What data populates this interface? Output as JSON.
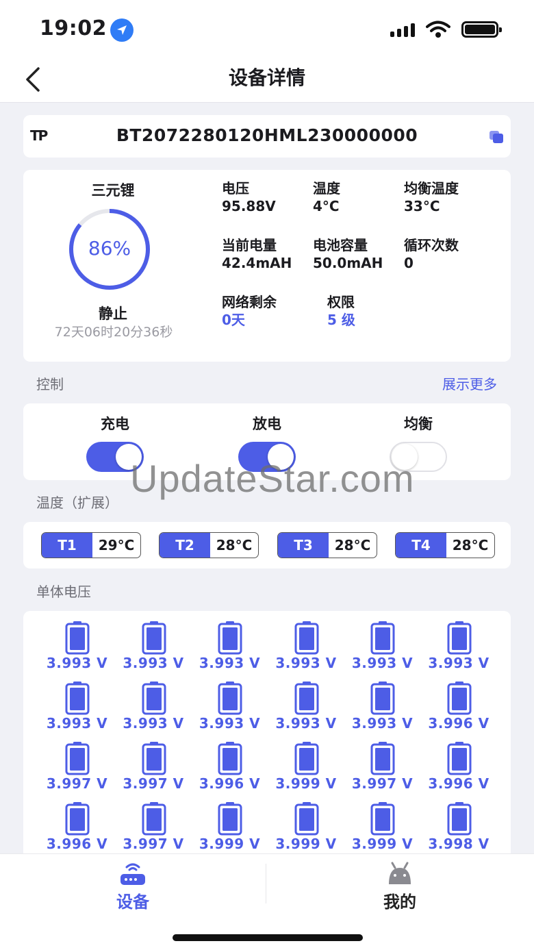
{
  "status_bar": {
    "time": "19:02"
  },
  "nav": {
    "title": "设备详情"
  },
  "device": {
    "brand": "TP",
    "id": "BT2072280120HML230000000"
  },
  "battery": {
    "type": "三元锂",
    "soc_percent": 86,
    "soc_text": "86%",
    "state": "静止",
    "duration": "72天06时20分36秒",
    "stats": [
      {
        "label": "电压",
        "value": "95.88V"
      },
      {
        "label": "温度",
        "value": "4°C"
      },
      {
        "label": "均衡温度",
        "value": "33°C"
      },
      {
        "label": "当前电量",
        "value": "42.4mAH"
      },
      {
        "label": "电池容量",
        "value": "50.0mAH"
      },
      {
        "label": "循环次数",
        "value": "0"
      },
      {
        "label": "网络剩余",
        "value": "0天"
      },
      {
        "label": "权限",
        "value": "5 级"
      }
    ]
  },
  "control": {
    "section_label": "控制",
    "show_more": "展示更多",
    "items": [
      {
        "label": "充电",
        "on": true
      },
      {
        "label": "放电",
        "on": true
      },
      {
        "label": "均衡",
        "on": false
      }
    ]
  },
  "temperature": {
    "section_label": "温度（扩展）",
    "items": [
      {
        "name": "T1",
        "value": "29°C"
      },
      {
        "name": "T2",
        "value": "28°C"
      },
      {
        "name": "T3",
        "value": "28°C"
      },
      {
        "name": "T4",
        "value": "28°C"
      }
    ]
  },
  "cells": {
    "section_label": "单体电压",
    "voltages": [
      "3.993 V",
      "3.993 V",
      "3.993 V",
      "3.993 V",
      "3.993 V",
      "3.993 V",
      "3.993 V",
      "3.993 V",
      "3.993 V",
      "3.993 V",
      "3.993 V",
      "3.996 V",
      "3.997 V",
      "3.997 V",
      "3.996 V",
      "3.999 V",
      "3.997 V",
      "3.996 V",
      "3.996 V",
      "3.997 V",
      "3.999 V",
      "3.999 V",
      "3.999 V",
      "3.998 V"
    ]
  },
  "tabs": [
    {
      "label": "设备",
      "icon": "router-icon",
      "active": true
    },
    {
      "label": "我的",
      "icon": "android-icon",
      "active": false
    }
  ],
  "watermark": "UpdateStar.com",
  "colors": {
    "accent": "#4d5de6",
    "background": "#f0f1f6",
    "muted": "#9a9aa2"
  }
}
